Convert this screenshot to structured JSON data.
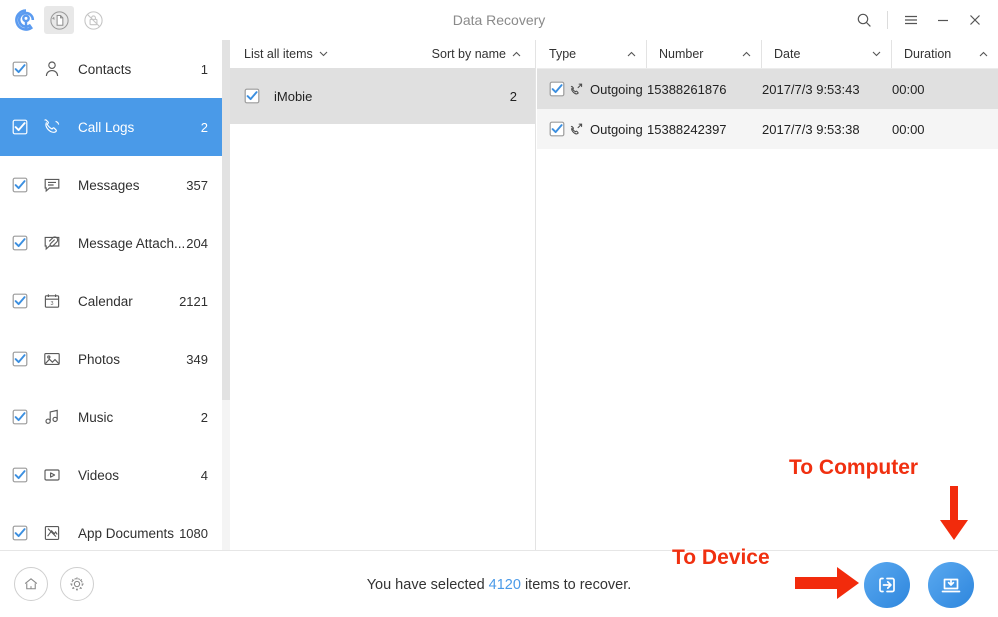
{
  "titlebar": {
    "title": "Data Recovery",
    "logo_icon": "imobie-p-logo-icon",
    "mode_recover_icon": "document-restore-icon",
    "mode_backup_icon": "locked-backup-icon",
    "search_icon": "search-icon",
    "menu_icon": "hamburger-menu-icon",
    "minimize_icon": "minimize-icon",
    "close_icon": "close-icon"
  },
  "sidebar": {
    "items": [
      {
        "label": "Contacts",
        "count": "1",
        "icon": "contact-person-icon",
        "checked": true,
        "selected": false
      },
      {
        "label": "Call Logs",
        "count": "2",
        "icon": "phone-handset-icon",
        "checked": true,
        "selected": true
      },
      {
        "label": "Messages",
        "count": "357",
        "icon": "message-bubble-icon",
        "checked": true,
        "selected": false
      },
      {
        "label": "Message Attach...",
        "count": "204",
        "icon": "message-attachment-icon",
        "checked": true,
        "selected": false
      },
      {
        "label": "Calendar",
        "count": "2121",
        "icon": "calendar-icon",
        "checked": true,
        "selected": false
      },
      {
        "label": "Photos",
        "count": "349",
        "icon": "photo-image-icon",
        "checked": true,
        "selected": false
      },
      {
        "label": "Music",
        "count": "2",
        "icon": "music-note-icon",
        "checked": true,
        "selected": false
      },
      {
        "label": "Videos",
        "count": "4",
        "icon": "video-play-icon",
        "checked": true,
        "selected": false
      },
      {
        "label": "App Documents",
        "count": "1080",
        "icon": "app-documents-icon",
        "checked": true,
        "selected": false
      }
    ]
  },
  "middle": {
    "filter_label": "List all items",
    "filter_caret": "chevron-down-icon",
    "sort_label": "Sort by name",
    "sort_caret": "chevron-up-icon",
    "rows": [
      {
        "label": "iMobie",
        "count": "2",
        "checked": true,
        "selected": true
      }
    ]
  },
  "table": {
    "columns": [
      {
        "label": "Type",
        "caret": "chevron-up-icon"
      },
      {
        "label": "Number",
        "caret": "chevron-up-icon"
      },
      {
        "label": "Date",
        "caret": "chevron-down-icon"
      },
      {
        "label": "Duration",
        "caret": "chevron-up-icon"
      }
    ],
    "rows": [
      {
        "type": "Outgoing",
        "number": "15388261876",
        "date": "2017/7/3 9:53:43",
        "duration": "00:00",
        "checked": true,
        "type_icon": "outgoing-call-icon"
      },
      {
        "type": "Outgoing",
        "number": "15388242397",
        "date": "2017/7/3 9:53:38",
        "duration": "00:00",
        "checked": true,
        "type_icon": "outgoing-call-icon"
      }
    ]
  },
  "bottom": {
    "home_icon": "home-icon",
    "settings_icon": "gear-icon",
    "status_prefix": "You have selected",
    "status_count": "4120",
    "status_suffix": "items to recover.",
    "to_device_button_icon": "recover-to-device-icon",
    "to_computer_button_icon": "recover-to-computer-icon"
  },
  "annotations": {
    "to_computer_label": "To Computer",
    "to_device_label": "To Device",
    "arrow_color": "#f22b0c",
    "label_color": "#f03010"
  },
  "colors": {
    "accent_blue": "#4a9ae8",
    "selected_row_gray": "#e0e0e0",
    "annotation_red": "#f03010"
  }
}
